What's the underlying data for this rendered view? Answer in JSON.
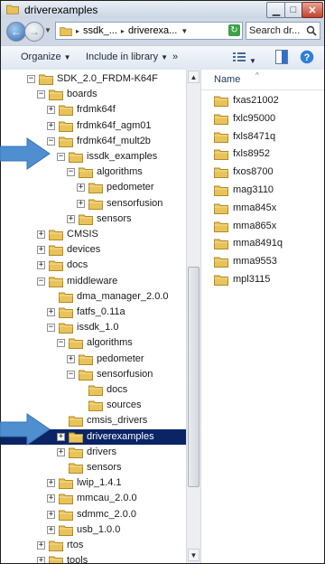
{
  "window": {
    "title": "driverexamples"
  },
  "address": {
    "segments": [
      "ssdk_...",
      "driverexa..."
    ]
  },
  "search": {
    "placeholder": "Search dr..."
  },
  "toolbar": {
    "organize_label": "Organize",
    "include_label": "Include in library",
    "more_label": "»"
  },
  "tree": [
    {
      "label": "SDK_2.0_FRDM-K64F",
      "level": 1,
      "expander": "minus"
    },
    {
      "label": "boards",
      "level": 2,
      "expander": "minus"
    },
    {
      "label": "frdmk64f",
      "level": 3,
      "expander": "plus"
    },
    {
      "label": "frdmk64f_agm01",
      "level": 3,
      "expander": "plus"
    },
    {
      "label": "frdmk64f_mult2b",
      "level": 3,
      "expander": "minus"
    },
    {
      "label": "issdk_examples",
      "level": 4,
      "expander": "minus"
    },
    {
      "label": "algorithms",
      "level": 5,
      "expander": "minus"
    },
    {
      "label": "pedometer",
      "level": 6,
      "expander": "plus"
    },
    {
      "label": "sensorfusion",
      "level": 6,
      "expander": "plus"
    },
    {
      "label": "sensors",
      "level": 5,
      "expander": "plus"
    },
    {
      "label": "CMSIS",
      "level": 2,
      "expander": "plus"
    },
    {
      "label": "devices",
      "level": 2,
      "expander": "plus"
    },
    {
      "label": "docs",
      "level": 2,
      "expander": "plus"
    },
    {
      "label": "middleware",
      "level": 2,
      "expander": "minus"
    },
    {
      "label": "dma_manager_2.0.0",
      "level": 3,
      "expander": "none"
    },
    {
      "label": "fatfs_0.11a",
      "level": 3,
      "expander": "plus"
    },
    {
      "label": "issdk_1.0",
      "level": 3,
      "expander": "minus"
    },
    {
      "label": "algorithms",
      "level": 4,
      "expander": "minus"
    },
    {
      "label": "pedometer",
      "level": 5,
      "expander": "plus"
    },
    {
      "label": "sensorfusion",
      "level": 5,
      "expander": "minus"
    },
    {
      "label": "docs",
      "level": 6,
      "expander": "none"
    },
    {
      "label": "sources",
      "level": 6,
      "expander": "none"
    },
    {
      "label": "cmsis_drivers",
      "level": 4,
      "expander": "none"
    },
    {
      "label": "driverexamples",
      "level": 4,
      "expander": "plus",
      "selected": true
    },
    {
      "label": "drivers",
      "level": 4,
      "expander": "plus"
    },
    {
      "label": "sensors",
      "level": 4,
      "expander": "none"
    },
    {
      "label": "lwip_1.4.1",
      "level": 3,
      "expander": "plus"
    },
    {
      "label": "mmcau_2.0.0",
      "level": 3,
      "expander": "plus"
    },
    {
      "label": "sdmmc_2.0.0",
      "level": 3,
      "expander": "plus"
    },
    {
      "label": "usb_1.0.0",
      "level": 3,
      "expander": "plus"
    },
    {
      "label": "rtos",
      "level": 2,
      "expander": "plus"
    },
    {
      "label": "tools",
      "level": 2,
      "expander": "plus"
    }
  ],
  "files": {
    "header": "Name",
    "items": [
      "fxas21002",
      "fxlc95000",
      "fxls8471q",
      "fxls8952",
      "fxos8700",
      "mag3110",
      "mma845x",
      "mma865x",
      "mma8491q",
      "mma9553",
      "mpl3115"
    ]
  },
  "colors": {
    "selection": "#0a2466",
    "arrow": "#4f8fd0",
    "folder": "#e8c35a"
  }
}
